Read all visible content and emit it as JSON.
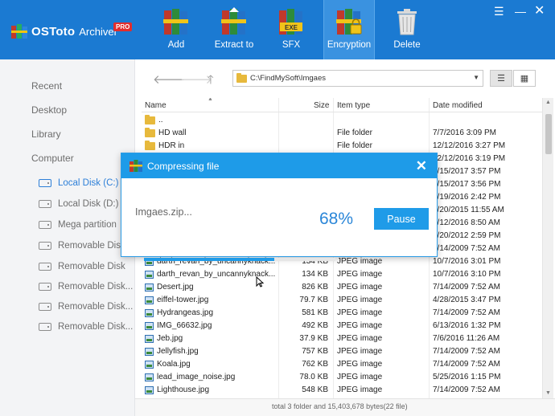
{
  "app": {
    "name": "OSToto",
    "subtitle": "Archiver",
    "badge": "PRO",
    "accent": "#1b7ad2"
  },
  "toolbar": [
    {
      "label": "Add",
      "icon": "books-add-icon"
    },
    {
      "label": "Extract to",
      "icon": "books-extract-icon"
    },
    {
      "label": "SFX",
      "icon": "books-sfx-icon"
    },
    {
      "label": "Encryption",
      "icon": "books-lock-icon"
    },
    {
      "label": "Delete",
      "icon": "trash-icon"
    }
  ],
  "sidebar": {
    "nav": [
      "Recent",
      "Desktop",
      "Library",
      "Computer"
    ],
    "drives": [
      {
        "label": "Local Disk (C:)",
        "selected": true
      },
      {
        "label": "Local Disk (D:)",
        "selected": false
      },
      {
        "label": "Mega partition",
        "selected": false
      },
      {
        "label": "Removable Disk",
        "selected": false
      },
      {
        "label": "Removable Disk",
        "selected": false
      },
      {
        "label": "Removable Disk...",
        "selected": false
      },
      {
        "label": "Removable Disk...",
        "selected": false
      },
      {
        "label": "Removable Disk...",
        "selected": false
      }
    ]
  },
  "address": {
    "path": "C:\\FindMySoft\\Imgaes"
  },
  "columns": {
    "name": "Name",
    "size": "Size",
    "type": "Item type",
    "date": "Date modified"
  },
  "files": [
    {
      "name": "..",
      "size": "",
      "type": "",
      "date": "",
      "kind": "folder"
    },
    {
      "name": "HD wall",
      "size": "",
      "type": "File folder",
      "date": "7/7/2016 3:09 PM",
      "kind": "folder"
    },
    {
      "name": "HDR in",
      "size": "",
      "type": "File folder",
      "date": "12/12/2016 3:27 PM",
      "kind": "folder"
    },
    {
      "name": "",
      "size": "",
      "type": "",
      "date": "12/12/2016 3:19 PM",
      "kind": "none"
    },
    {
      "name": "",
      "size": "",
      "type": "",
      "date": "3/15/2017 3:57 PM",
      "kind": "none"
    },
    {
      "name": "",
      "size": "",
      "type": "",
      "date": "3/15/2017 3:56 PM",
      "kind": "none"
    },
    {
      "name": "",
      "size": "",
      "type": "",
      "date": "7/19/2016 2:42 PM",
      "kind": "none"
    },
    {
      "name": "",
      "size": "",
      "type": "",
      "date": "4/20/2015 11:55 AM",
      "kind": "none"
    },
    {
      "name": "",
      "size": "",
      "type": "",
      "date": "4/12/2016 8:50 AM",
      "kind": "none"
    },
    {
      "name": "",
      "size": "",
      "type": "",
      "date": "3/20/2012 2:59 PM",
      "kind": "none"
    },
    {
      "name": "",
      "size": "",
      "type": "",
      "date": "7/14/2009 7:52 AM",
      "kind": "none"
    },
    {
      "name": "darth_revan_by_uncannyknack...",
      "size": "134 KB",
      "type": "JPEG image",
      "date": "10/7/2016 3:01 PM",
      "kind": "image"
    },
    {
      "name": "darth_revan_by_uncannyknack...",
      "size": "134 KB",
      "type": "JPEG image",
      "date": "10/7/2016 3:10 PM",
      "kind": "image"
    },
    {
      "name": "Desert.jpg",
      "size": "826 KB",
      "type": "JPEG image",
      "date": "7/14/2009 7:52 AM",
      "kind": "image"
    },
    {
      "name": "eiffel-tower.jpg",
      "size": "79.7 KB",
      "type": "JPEG image",
      "date": "4/28/2015 3:47 PM",
      "kind": "image"
    },
    {
      "name": "Hydrangeas.jpg",
      "size": "581 KB",
      "type": "JPEG image",
      "date": "7/14/2009 7:52 AM",
      "kind": "image"
    },
    {
      "name": "IMG_66632.jpg",
      "size": "492 KB",
      "type": "JPEG image",
      "date": "6/13/2016 1:32 PM",
      "kind": "image"
    },
    {
      "name": "Jeb.jpg",
      "size": "37.9 KB",
      "type": "JPEG image",
      "date": "7/6/2016 11:26 AM",
      "kind": "image"
    },
    {
      "name": "Jellyfish.jpg",
      "size": "757 KB",
      "type": "JPEG image",
      "date": "7/14/2009 7:52 AM",
      "kind": "image"
    },
    {
      "name": "Koala.jpg",
      "size": "762 KB",
      "type": "JPEG image",
      "date": "7/14/2009 7:52 AM",
      "kind": "image"
    },
    {
      "name": "lead_image_noise.jpg",
      "size": "78.0 KB",
      "type": "JPEG image",
      "date": "5/25/2016 1:15 PM",
      "kind": "image"
    },
    {
      "name": "Lighthouse.jpg",
      "size": "548 KB",
      "type": "JPEG image",
      "date": "7/14/2009 7:52 AM",
      "kind": "image"
    }
  ],
  "status": {
    "text": "total 3 folder and 15,403,678 bytes(22 file)"
  },
  "dialog": {
    "title": "Compressing file",
    "file": "Imgaes.zip...",
    "percent_label": "68%",
    "progress": 0.68,
    "pause_label": "Pause"
  }
}
